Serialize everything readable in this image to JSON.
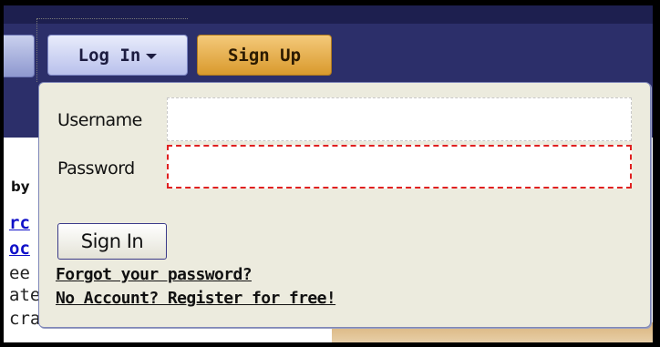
{
  "nav": {
    "login_label": "Log In",
    "signup_label": "Sign Up"
  },
  "background": {
    "by_text": "by",
    "lines": [
      {
        "text": "rc",
        "link": true
      },
      {
        "text": "oc",
        "link": true
      },
      {
        "text": "ee",
        "link": false
      },
      {
        "text": "ate",
        "link": false
      },
      {
        "text": "craft",
        "link": false
      }
    ]
  },
  "login_popup": {
    "username_label": "Username",
    "password_label": "Password",
    "username_value": "",
    "password_value": "",
    "signin_label": "Sign In",
    "forgot_link": "Forgot your password?",
    "register_link": "No Account? Register for free!"
  },
  "colors": {
    "header_bg": "#2c2f6a",
    "login_button": "#b9c1ec",
    "signup_button": "#e0a43a",
    "popup_bg": "#ecebde",
    "error_border": "#e02020"
  }
}
